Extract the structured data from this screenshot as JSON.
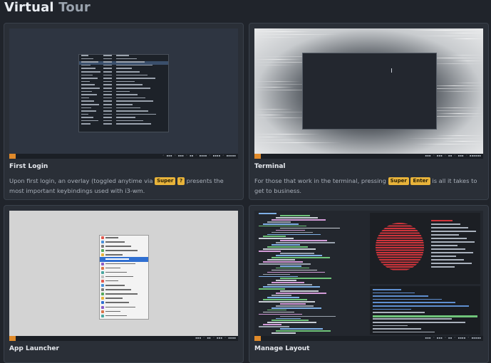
{
  "page": {
    "title_part1": "Virtual",
    "title_part2": "Tour"
  },
  "cards": [
    {
      "title": "First Login",
      "desc_before": "Upon first login, an overlay (toggled anytime via",
      "keys": [
        "Super",
        "?"
      ],
      "desc_after": "presents the most important keybindings used with i3-wm."
    },
    {
      "title": "Terminal",
      "desc_before": "For those that work in the terminal, pressing",
      "keys": [
        "Super",
        "Enter"
      ],
      "desc_after": "is all it takes to get to business."
    },
    {
      "title": "App Launcher"
    },
    {
      "title": "Manage Layout"
    }
  ],
  "colors": {
    "background": "#20242b",
    "card": "#2a2f37",
    "key_badge": "#e8b33a",
    "workspace_indicator": "#e08a2a"
  }
}
